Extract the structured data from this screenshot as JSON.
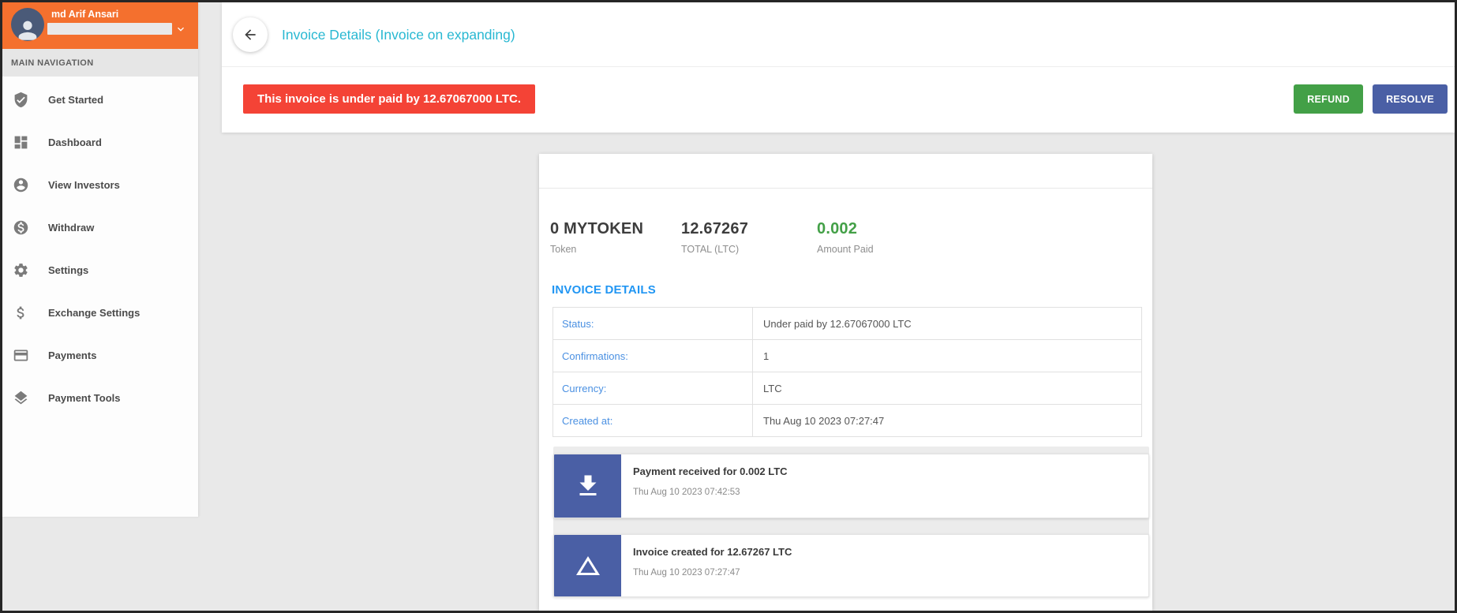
{
  "user": {
    "name": "md Arif Ansari"
  },
  "sidebar": {
    "section_label": "MAIN NAVIGATION",
    "items": [
      {
        "label": "Get Started",
        "icon": "shield-check-icon"
      },
      {
        "label": "Dashboard",
        "icon": "dashboard-icon"
      },
      {
        "label": "View Investors",
        "icon": "person-circle-icon"
      },
      {
        "label": "Withdraw",
        "icon": "dollar-circle-icon"
      },
      {
        "label": "Settings",
        "icon": "gear-icon"
      },
      {
        "label": "Exchange Settings",
        "icon": "dollar-icon"
      },
      {
        "label": "Payments",
        "icon": "credit-card-icon"
      },
      {
        "label": "Payment Tools",
        "icon": "layers-icon"
      }
    ]
  },
  "header": {
    "title": "Invoice Details (Invoice on expanding)"
  },
  "alert": {
    "message": "This invoice is under paid by 12.67067000 LTC."
  },
  "actions": {
    "refund_label": "REFUND",
    "resolve_label": "RESOLVE"
  },
  "invoice": {
    "stats": [
      {
        "value": "0 MYTOKEN",
        "label": "Token"
      },
      {
        "value": "12.67267",
        "label": "TOTAL (LTC)"
      },
      {
        "value": "0.002",
        "label": "Amount Paid"
      }
    ],
    "details_heading": "INVOICE DETAILS",
    "details": [
      {
        "label": "Status:",
        "value": "Under paid by 12.67067000 LTC"
      },
      {
        "label": "Confirmations:",
        "value": "1"
      },
      {
        "label": "Currency:",
        "value": "LTC"
      },
      {
        "label": "Created at:",
        "value": "Thu Aug 10 2023 07:27:47"
      }
    ],
    "timeline": [
      {
        "icon": "download-icon",
        "title": "Payment received for 0.002 LTC",
        "timestamp": "Thu Aug 10 2023 07:42:53"
      },
      {
        "icon": "triangle-icon",
        "title": "Invoice created for 12.67267 LTC",
        "timestamp": "Thu Aug 10 2023 07:27:47"
      }
    ]
  },
  "colors": {
    "orange": "#f4702e",
    "avatar-bg": "#4a5a78",
    "page-bg": "#e9e9e9",
    "title-cyan": "#29b8d2",
    "alert-red": "#f44336",
    "green": "#43a047",
    "indigo": "#4a5fa5",
    "blue": "#2196f3",
    "link-blue": "#4a90e2"
  }
}
